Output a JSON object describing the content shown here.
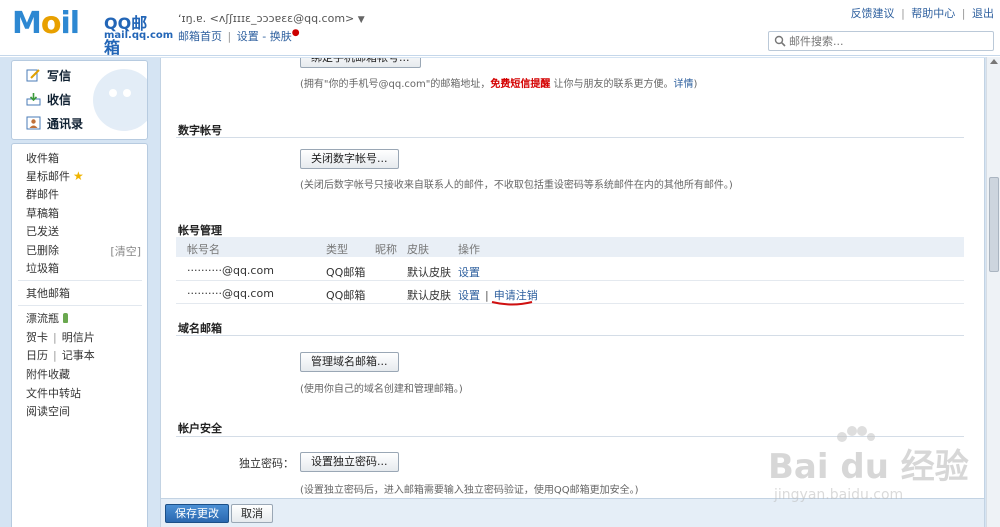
{
  "header": {
    "logo": {
      "mail_word_start": "M",
      "mail_word_o": "o",
      "mail_word_end": "il",
      "brand": "QQ邮箱",
      "domain": "mail.qq.com"
    },
    "account": "ʻɪŋ.ɐ.  <ʌʃʃɪɪɪɛ_ɔɔɔɐɛɛ@qq.com>",
    "account_arrow": "▼",
    "subnav": {
      "home": "邮箱首页",
      "sep": "|",
      "settings": "设置",
      "dash": "-",
      "switch": "换肤"
    },
    "toplinks": {
      "feedback": "反馈建议",
      "help": "帮助中心",
      "logout": "退出",
      "sep": "|"
    },
    "search": {
      "placeholder": "邮件搜索..."
    }
  },
  "sidebar": {
    "actions": [
      {
        "label": "写信",
        "icon": "pencil-icon"
      },
      {
        "label": "收信",
        "icon": "inbox-download-icon"
      },
      {
        "label": "通讯录",
        "icon": "contacts-icon"
      }
    ],
    "folders": {
      "inbox": "收件箱",
      "starred": "星标邮件",
      "group": "群邮件",
      "drafts": "草稿箱",
      "sent": "已发送",
      "deleted": "已删除",
      "clear": "[清空]",
      "spam": "垃圾箱",
      "other": "其他邮箱",
      "bottle": "漂流瓶",
      "card": "贺卡",
      "postcard": "明信片",
      "calendar": "日历",
      "notes": "记事本",
      "attachments": "附件收藏",
      "transfer": "文件中转站",
      "reading": "阅读空间"
    },
    "pipe": "|"
  },
  "main": {
    "phone": {
      "button": "绑定手机邮箱帐号...",
      "note_pre": "(拥有\"你的手机号@qq.com\"的邮箱地址，",
      "note_red": "免费短信提醒",
      "note_post": " 让你与朋友的联系更方便。",
      "note_link": "详情",
      "note_end": ")"
    },
    "digital": {
      "title": "数字帐号",
      "button": "关闭数字帐号...",
      "note": "(关闭后数字帐号只接收来自联系人的邮件，不收取包括重设密码等系统邮件在内的其他所有邮件。)"
    },
    "accounts": {
      "title": "帐号管理",
      "headers": {
        "name": "帐号名",
        "type": "类型",
        "nickname": "昵称",
        "skin": "皮肤",
        "action": "操作"
      },
      "rows": [
        {
          "name": "··········@qq.com",
          "type": "QQ邮箱",
          "skin": "默认皮肤",
          "settings": "设置",
          "pipe": "",
          "cancel": ""
        },
        {
          "name": "··········@qq.com",
          "type": "QQ邮箱",
          "skin": "默认皮肤",
          "settings": "设置",
          "pipe": "|",
          "cancel": "申请注销"
        }
      ]
    },
    "domain": {
      "title": "域名邮箱",
      "button": "管理域名邮箱...",
      "note": "(使用你自己的域名创建和管理邮箱。)"
    },
    "security": {
      "title": "帐户安全",
      "label": "独立密码：",
      "button": "设置独立密码...",
      "note": "(设置独立密码后，进入邮箱需要输入独立密码验证，使用QQ邮箱更加安全。)"
    }
  },
  "footer": {
    "save": "保存更改",
    "cancel": "取消"
  },
  "watermark": {
    "main": "Bai du 经验",
    "sub": "jingyan.baidu.com"
  },
  "colors": {
    "brand": "#2d88d2",
    "link": "#2d5f9e",
    "highlight": "#d40000",
    "background": "#d5e4f3"
  }
}
